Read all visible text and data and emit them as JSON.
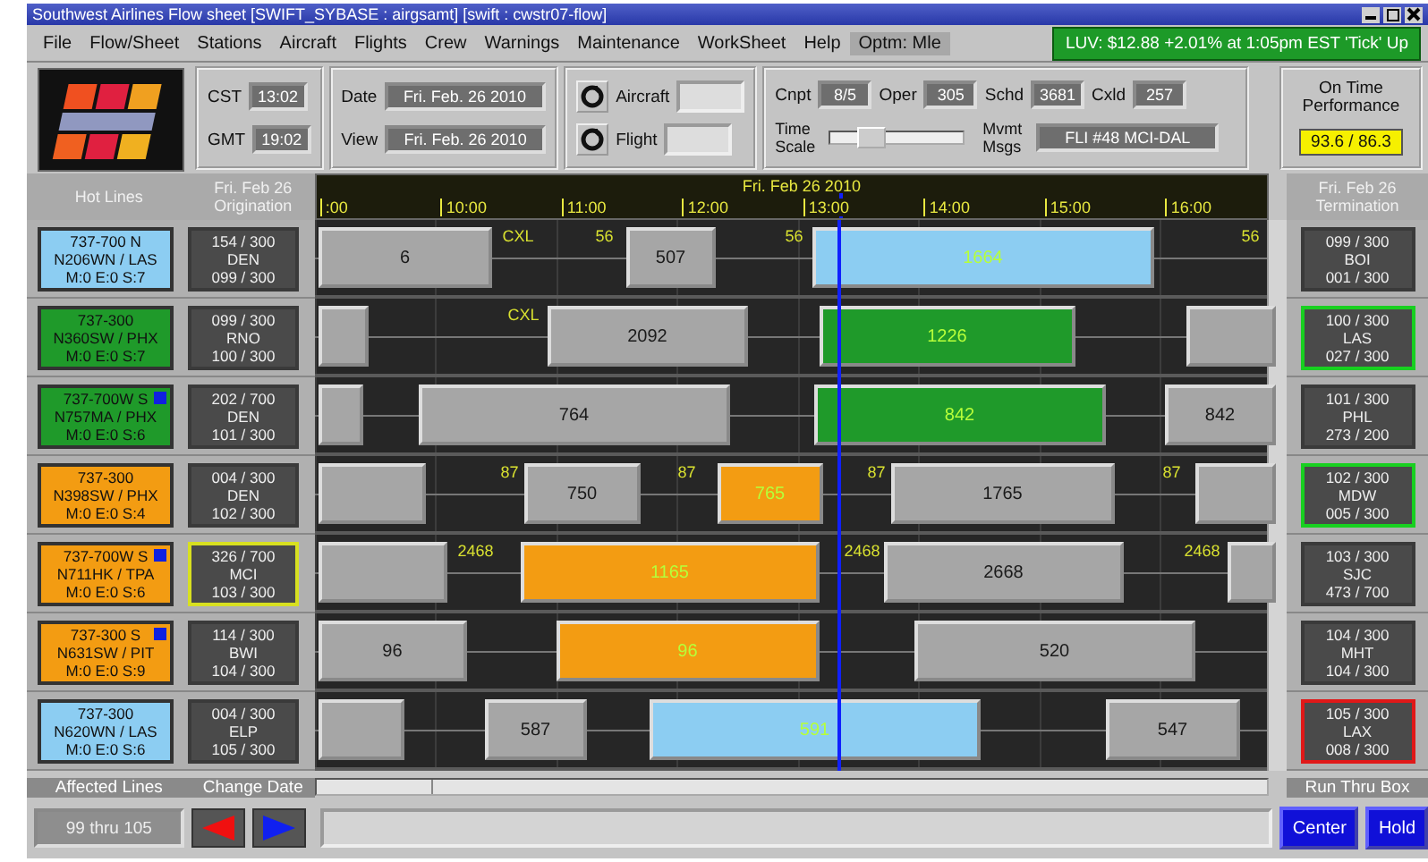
{
  "window": {
    "title": "Southwest Airlines Flow sheet  [SWIFT_SYBASE : airgsamt]  [swift : cwstr07-flow]"
  },
  "menu": [
    {
      "label": "File",
      "selected": false
    },
    {
      "label": "Flow/Sheet",
      "selected": false
    },
    {
      "label": "Stations",
      "selected": false
    },
    {
      "label": "Aircraft",
      "selected": false
    },
    {
      "label": "Flights",
      "selected": false
    },
    {
      "label": "Crew",
      "selected": false
    },
    {
      "label": "Warnings",
      "selected": false
    },
    {
      "label": "Maintenance",
      "selected": false
    },
    {
      "label": "WorkSheet",
      "selected": false
    },
    {
      "label": "Help",
      "selected": false
    },
    {
      "label": "Optm: Mle",
      "selected": true
    }
  ],
  "ticker": "LUV: $12.88 +2.01% at 1:05pm EST 'Tick' Up",
  "clock": [
    {
      "label": "CST",
      "value": "13:02"
    },
    {
      "label": "GMT",
      "value": "19:02"
    }
  ],
  "dates": [
    {
      "label": "Date",
      "value": "Fri. Feb. 26 2010"
    },
    {
      "label": "View",
      "value": "Fri. Feb. 26 2010"
    }
  ],
  "lookup": [
    {
      "label": "Aircraft"
    },
    {
      "label": "Flight"
    }
  ],
  "counts": [
    {
      "label": "Cnpt",
      "value": "8/5"
    },
    {
      "label": "Oper",
      "value": "305"
    },
    {
      "label": "Schd",
      "value": "3681"
    },
    {
      "label": "Cxld",
      "value": "257"
    }
  ],
  "time_scale": {
    "label": "Time Scale",
    "level": 0.3
  },
  "movement": {
    "label": "Mvmt Msgs",
    "value": "FLI #48 MCI-DAL"
  },
  "on_time": {
    "title": "On Time Performance",
    "value": "93.6 / 86.3"
  },
  "columns": {
    "lines": "Hot Lines",
    "origination": "Fri. Feb 26 Origination",
    "timeline_date": "Fri. Feb 26 2010",
    "termination": "Fri. Feb 26 Termination"
  },
  "hours": [
    ":00",
    "10:00",
    "11:00",
    "12:00",
    "13:00",
    "14:00",
    "15:00",
    "16:00"
  ],
  "rows": [
    {
      "aircraft": {
        "lines": [
          "737-700 N",
          "N206WN / LAS",
          "M:0 E:0 S:7"
        ],
        "color": "#8ccdf2",
        "flag": false
      },
      "origination": {
        "lines": [
          "154 / 300",
          "DEN",
          "099 / 300"
        ],
        "color": "#3a3a3a"
      },
      "termination": {
        "lines": [
          "099 / 300",
          "BOI",
          "001 / 300"
        ],
        "color": "#3a3a3a"
      },
      "bars": [
        {
          "kind": "bar",
          "label": "6",
          "color": "#a6a6a6"
        },
        {
          "kind": "tag",
          "label": "CXL"
        },
        {
          "kind": "tag",
          "label": "56"
        },
        {
          "kind": "bar",
          "label": "507",
          "color": "#a6a6a6"
        },
        {
          "kind": "tag",
          "label": "56"
        },
        {
          "kind": "bar",
          "label": "1664",
          "color": "#8ccdf2"
        },
        {
          "kind": "tag",
          "label": "56"
        }
      ]
    },
    {
      "aircraft": {
        "lines": [
          "737-300",
          "N360SW / PHX",
          "M:0 E:0 S:7"
        ],
        "color": "#1f9a2a",
        "flag": false
      },
      "origination": {
        "lines": [
          "099 / 300",
          "RNO",
          "100 / 300"
        ],
        "color": "#3a3a3a"
      },
      "termination": {
        "lines": [
          "100 / 300",
          "LAS",
          "027 / 300"
        ],
        "color": "#18d020"
      },
      "bars": [
        {
          "kind": "bar",
          "color": "#a6a6a6"
        },
        {
          "kind": "tag",
          "label": "CXL"
        },
        {
          "kind": "bar",
          "label": "2092",
          "color": "#a6a6a6"
        },
        {
          "kind": "bar",
          "label": "1226",
          "color": "#1f9a2a"
        },
        {
          "kind": "bar",
          "color": "#a6a6a6"
        }
      ]
    },
    {
      "aircraft": {
        "lines": [
          "737-700W S",
          "N757MA / PHX",
          "M:0 E:0 S:6"
        ],
        "color": "#1f9a2a",
        "flag": true
      },
      "origination": {
        "lines": [
          "202 / 700",
          "DEN",
          "101 / 300"
        ],
        "color": "#3a3a3a"
      },
      "termination": {
        "lines": [
          "101 / 300",
          "PHL",
          "273 / 200"
        ],
        "color": "#3a3a3a"
      },
      "bars": [
        {
          "kind": "bar",
          "color": "#a6a6a6"
        },
        {
          "kind": "bar",
          "label": "764",
          "color": "#a6a6a6"
        },
        {
          "kind": "bar",
          "label": "842",
          "color": "#1f9a2a"
        },
        {
          "kind": "bar",
          "label": "842",
          "color": "#a6a6a6"
        }
      ]
    },
    {
      "aircraft": {
        "lines": [
          "737-300",
          "N398SW / PHX",
          "M:0 E:0 S:4"
        ],
        "color": "#f39c12",
        "flag": false
      },
      "origination": {
        "lines": [
          "004 / 300",
          "DEN",
          "102 / 300"
        ],
        "color": "#3a3a3a"
      },
      "termination": {
        "lines": [
          "102 / 300",
          "MDW",
          "005 / 300"
        ],
        "color": "#18d020"
      },
      "bars": [
        {
          "kind": "bar",
          "color": "#a6a6a6"
        },
        {
          "kind": "tag",
          "label": "87"
        },
        {
          "kind": "bar",
          "label": "750",
          "color": "#a6a6a6"
        },
        {
          "kind": "tag",
          "label": "87"
        },
        {
          "kind": "bar",
          "label": "765",
          "color": "#f39c12"
        },
        {
          "kind": "tag",
          "label": "87"
        },
        {
          "kind": "bar",
          "label": "1765",
          "color": "#a6a6a6"
        },
        {
          "kind": "tag",
          "label": "87"
        },
        {
          "kind": "bar",
          "color": "#a6a6a6"
        }
      ]
    },
    {
      "aircraft": {
        "lines": [
          "737-700W S",
          "N711HK / TPA",
          "M:0 E:0 S:6"
        ],
        "color": "#f39c12",
        "flag": true
      },
      "origination": {
        "lines": [
          "326 / 700",
          "MCI",
          "103 / 300"
        ],
        "color": "#d8e020"
      },
      "termination": {
        "lines": [
          "103 / 300",
          "SJC",
          "473 / 700"
        ],
        "color": "#3a3a3a"
      },
      "bars": [
        {
          "kind": "bar",
          "color": "#a6a6a6"
        },
        {
          "kind": "tag",
          "label": "2468"
        },
        {
          "kind": "bar",
          "label": "1165",
          "color": "#f39c12"
        },
        {
          "kind": "tag",
          "label": "2468"
        },
        {
          "kind": "bar",
          "label": "2668",
          "color": "#a6a6a6"
        },
        {
          "kind": "tag",
          "label": "2468"
        },
        {
          "kind": "bar",
          "color": "#a6a6a6"
        }
      ]
    },
    {
      "aircraft": {
        "lines": [
          "737-300 S",
          "N631SW / PIT",
          "M:0 E:0 S:9"
        ],
        "color": "#f39c12",
        "flag": true
      },
      "origination": {
        "lines": [
          "114 / 300",
          "BWI",
          "104 / 300"
        ],
        "color": "#3a3a3a"
      },
      "termination": {
        "lines": [
          "104 / 300",
          "MHT",
          "104 / 300"
        ],
        "color": "#3a3a3a"
      },
      "bars": [
        {
          "kind": "bar",
          "label": "96",
          "color": "#a6a6a6"
        },
        {
          "kind": "bar",
          "label": "96",
          "color": "#f39c12"
        },
        {
          "kind": "bar",
          "label": "520",
          "color": "#a6a6a6"
        }
      ]
    },
    {
      "aircraft": {
        "lines": [
          "737-300",
          "N620WN / LAS",
          "M:0 E:0 S:6"
        ],
        "color": "#8ccdf2",
        "flag": false
      },
      "origination": {
        "lines": [
          "004 / 300",
          "ELP",
          "105 / 300"
        ],
        "color": "#3a3a3a"
      },
      "termination": {
        "lines": [
          "105 / 300",
          "LAX",
          "008 / 300"
        ],
        "color": "#e01818"
      },
      "bars": [
        {
          "kind": "bar",
          "color": "#a6a6a6"
        },
        {
          "kind": "bar",
          "label": "587",
          "color": "#a6a6a6"
        },
        {
          "kind": "bar",
          "label": "591",
          "color": "#8ccdf2"
        },
        {
          "kind": "bar",
          "label": "547",
          "color": "#a6a6a6"
        }
      ]
    }
  ],
  "footer": {
    "lines_label": "Affected Lines",
    "lines_value": "99 thru 105",
    "date_label": "Change Date",
    "box_label": "Run Thru Box",
    "buttons": [
      "Center",
      "Hold"
    ]
  }
}
